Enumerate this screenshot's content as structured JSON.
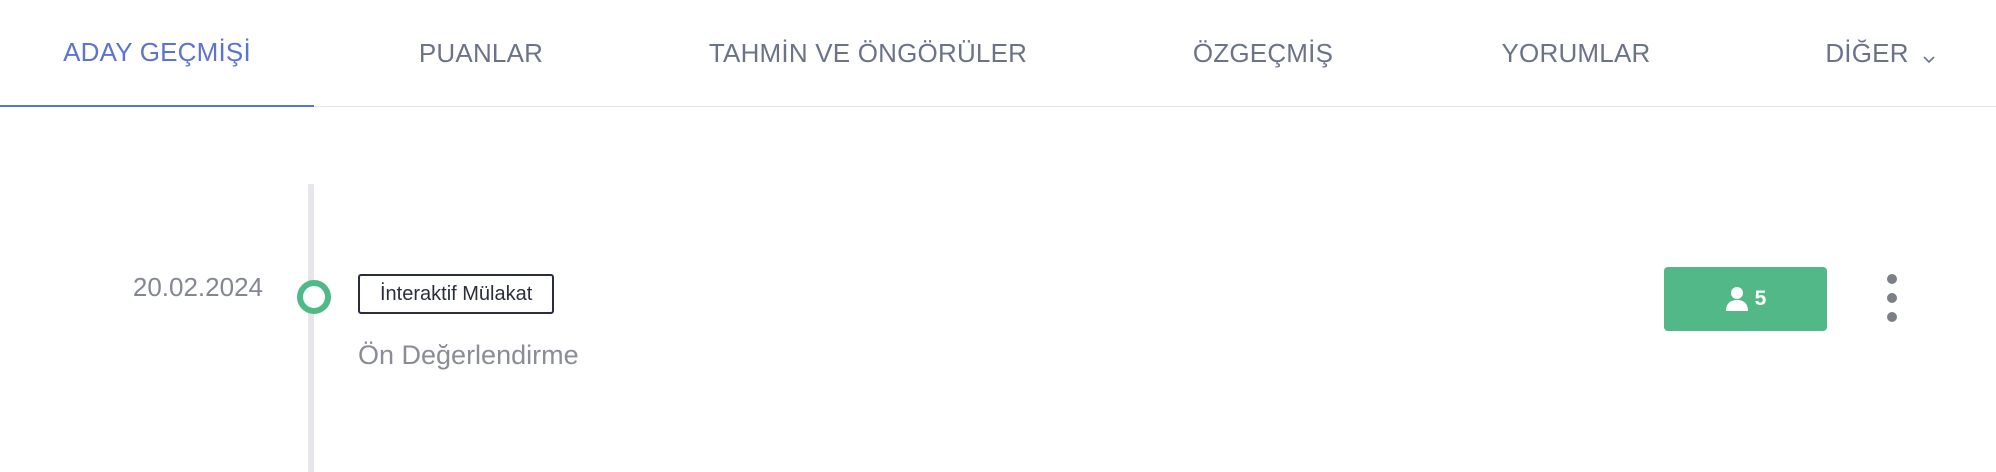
{
  "tabs": [
    {
      "label": "ADAY GEÇMİŞİ",
      "active": true
    },
    {
      "label": "PUANLAR",
      "active": false
    },
    {
      "label": "TAHMİN VE ÖNGÖRÜLER",
      "active": false
    },
    {
      "label": "ÖZGEÇMİŞ",
      "active": false
    },
    {
      "label": "YORUMLAR",
      "active": false
    },
    {
      "label": "DİĞER",
      "active": false,
      "icon": "chevron-down-icon"
    }
  ],
  "timeline": {
    "entries": [
      {
        "date": "20.02.2024",
        "tag": "İnteraktif Mülakat",
        "subtitle": "Ön Değerlendirme",
        "participant_count": "5",
        "participant_icon": "user-icon",
        "menu_icon": "more-vertical-icon"
      }
    ]
  },
  "colors": {
    "accent": "#5b74d0",
    "success": "#52b887",
    "text_muted": "#6b7389"
  }
}
